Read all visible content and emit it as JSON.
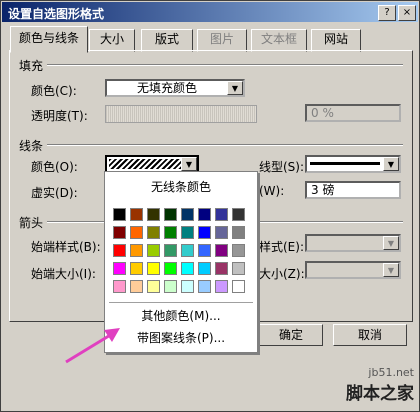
{
  "window": {
    "title": "设置自选图形格式",
    "help_button": "?",
    "close_button": "×"
  },
  "tabs": [
    {
      "label": "颜色与线条",
      "active": true
    },
    {
      "label": "大小",
      "active": false
    },
    {
      "label": "版式",
      "active": false
    },
    {
      "label": "图片",
      "disabled": true
    },
    {
      "label": "文本框",
      "disabled": true
    },
    {
      "label": "网站",
      "active": false
    }
  ],
  "fill": {
    "section": "填充",
    "color_label": "颜色(C):",
    "color_value": "无填充颜色",
    "transparency_label": "透明度(T):",
    "transparency_value": "0 %"
  },
  "line": {
    "section": "线条",
    "color_label": "颜色(O):",
    "dash_label": "虚实(D):",
    "style_label": "线型(S):",
    "weight_label": "(W):",
    "weight_value": "3 磅"
  },
  "arrows": {
    "section": "箭头",
    "begin_style_label": "始端样式(B):",
    "begin_size_label": "始端大小(I):",
    "end_style_label": "样式(E):",
    "end_size_label": "大小(Z):"
  },
  "color_menu": {
    "no_line": "无线条颜色",
    "more_colors": "其他颜色(M)...",
    "patterned_lines": "带图案线条(P)...",
    "swatches": [
      [
        "#000000",
        "#993300",
        "#333300",
        "#003300",
        "#003366",
        "#000080",
        "#333399",
        "#333333"
      ],
      [
        "#800000",
        "#ff6600",
        "#808000",
        "#008000",
        "#008080",
        "#0000ff",
        "#666699",
        "#808080"
      ],
      [
        "#ff0000",
        "#ff9900",
        "#99cc00",
        "#339966",
        "#33cccc",
        "#3366ff",
        "#800080",
        "#969696"
      ],
      [
        "#ff00ff",
        "#ffcc00",
        "#ffff00",
        "#00ff00",
        "#00ffff",
        "#00ccff",
        "#993366",
        "#c0c0c0"
      ],
      [
        "#ff99cc",
        "#ffcc99",
        "#ffff99",
        "#ccffcc",
        "#ccffff",
        "#99ccff",
        "#cc99ff",
        "#ffffff"
      ]
    ]
  },
  "buttons": {
    "ok": "确定",
    "cancel": "取消"
  },
  "watermark": {
    "site": "jb51.net",
    "name": "脚本之家"
  },
  "colors": {
    "arrow": "#e040c0",
    "title_bg": "#0a246a"
  }
}
